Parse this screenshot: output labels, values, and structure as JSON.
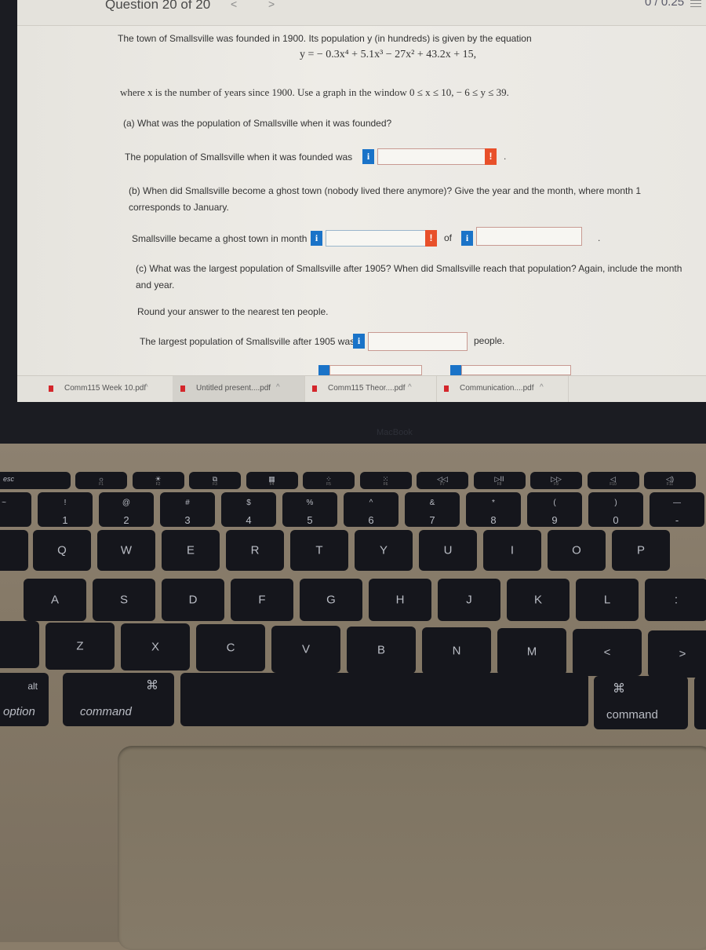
{
  "header": {
    "question_title": "Question 20 of 20",
    "prev_icon": "chevron-left-icon",
    "next_icon": "chevron-right-icon",
    "score": "0 / 0.25",
    "menu_icon": "list-menu-icon"
  },
  "problem": {
    "intro": "The town of Smallsville was founded in 1900. Its population  y (in hundreds) is given by the equation",
    "equation": "y = − 0.3x⁴ + 5.1x³ − 27x² + 43.2x + 15,",
    "window_text": "where x is the number of years since 1900. Use a graph in the window 0 ≤ x ≤ 10,  − 6 ≤ y ≤ 39.",
    "part_a": {
      "question": "(a) What was the population of Smallsville when it was founded?",
      "prompt": "The population of Smallsville when it was founded was",
      "answer_value": "",
      "error_mark": "!",
      "suffix": "."
    },
    "part_b": {
      "question_line1": "(b) When did Smallsville become a ghost town (nobody lived there anymore)? Give the year and the month, where month 1",
      "question_line2": "corresponds to January.",
      "prompt": "Smallsville became a ghost town in month",
      "month_value": "",
      "error_mark": "!",
      "of_label": "of",
      "year_value": "",
      "suffix": "."
    },
    "part_c": {
      "question_line1": "(c) What was the largest population of Smallsville after 1905? When did Smallsville reach that population? Again, include the month",
      "question_line2": "and year.",
      "round_note": "Round your answer to the nearest ten people.",
      "prompt": "The largest population of Smallsville after 1905 was",
      "answer_value": "",
      "suffix": "people."
    },
    "info_label": "i"
  },
  "downloads": [
    {
      "name": "Comm115 Week 10.pdf",
      "icon": "pdf-file-icon"
    },
    {
      "name": "Untitled present....pdf",
      "icon": "pdf-file-icon"
    },
    {
      "name": "Comm115 Theor....pdf",
      "icon": "pdf-file-icon"
    },
    {
      "name": "Communication....pdf",
      "icon": "pdf-file-icon"
    }
  ],
  "download_caret": "^",
  "laptop_brand": "MacBook",
  "keyboard": {
    "function_row": [
      {
        "top": "esc",
        "sub": ""
      },
      {
        "top": "☼",
        "sub": "F1"
      },
      {
        "top": "☀",
        "sub": "F2"
      },
      {
        "top": "⧉",
        "sub": "F3"
      },
      {
        "top": "▦",
        "sub": "F4"
      },
      {
        "top": "⁘",
        "sub": "F5"
      },
      {
        "top": "⁙",
        "sub": "F6"
      },
      {
        "top": "◁◁",
        "sub": "F7"
      },
      {
        "top": "▷II",
        "sub": "F8"
      },
      {
        "top": "▷▷",
        "sub": "F9"
      },
      {
        "top": "◁",
        "sub": "F10"
      },
      {
        "top": "◁)",
        "sub": "F11"
      }
    ],
    "number_row": [
      {
        "top": "~",
        "bot": ""
      },
      {
        "top": "!",
        "bot": "1"
      },
      {
        "top": "@",
        "bot": "2"
      },
      {
        "top": "#",
        "bot": "3"
      },
      {
        "top": "$",
        "bot": "4"
      },
      {
        "top": "%",
        "bot": "5"
      },
      {
        "top": "^",
        "bot": "6"
      },
      {
        "top": "&",
        "bot": "7"
      },
      {
        "top": "*",
        "bot": "8"
      },
      {
        "top": "(",
        "bot": "9"
      },
      {
        "top": ")",
        "bot": "0"
      },
      {
        "top": "—",
        "bot": "-"
      }
    ],
    "qwerty_row": [
      "Q",
      "W",
      "E",
      "R",
      "T",
      "Y",
      "U",
      "I",
      "O",
      "P"
    ],
    "home_row": [
      "A",
      "S",
      "D",
      "F",
      "G",
      "H",
      "J",
      "K",
      "L",
      ":"
    ],
    "bottom_row": [
      "Z",
      "X",
      "C",
      "V",
      "B",
      "N",
      "M",
      "<",
      ">"
    ],
    "left_option": {
      "top": "alt",
      "bottom": "option"
    },
    "left_command": {
      "top": "⌘",
      "bottom": "command"
    },
    "right_command": {
      "top": "⌘",
      "bottom": "command"
    }
  }
}
